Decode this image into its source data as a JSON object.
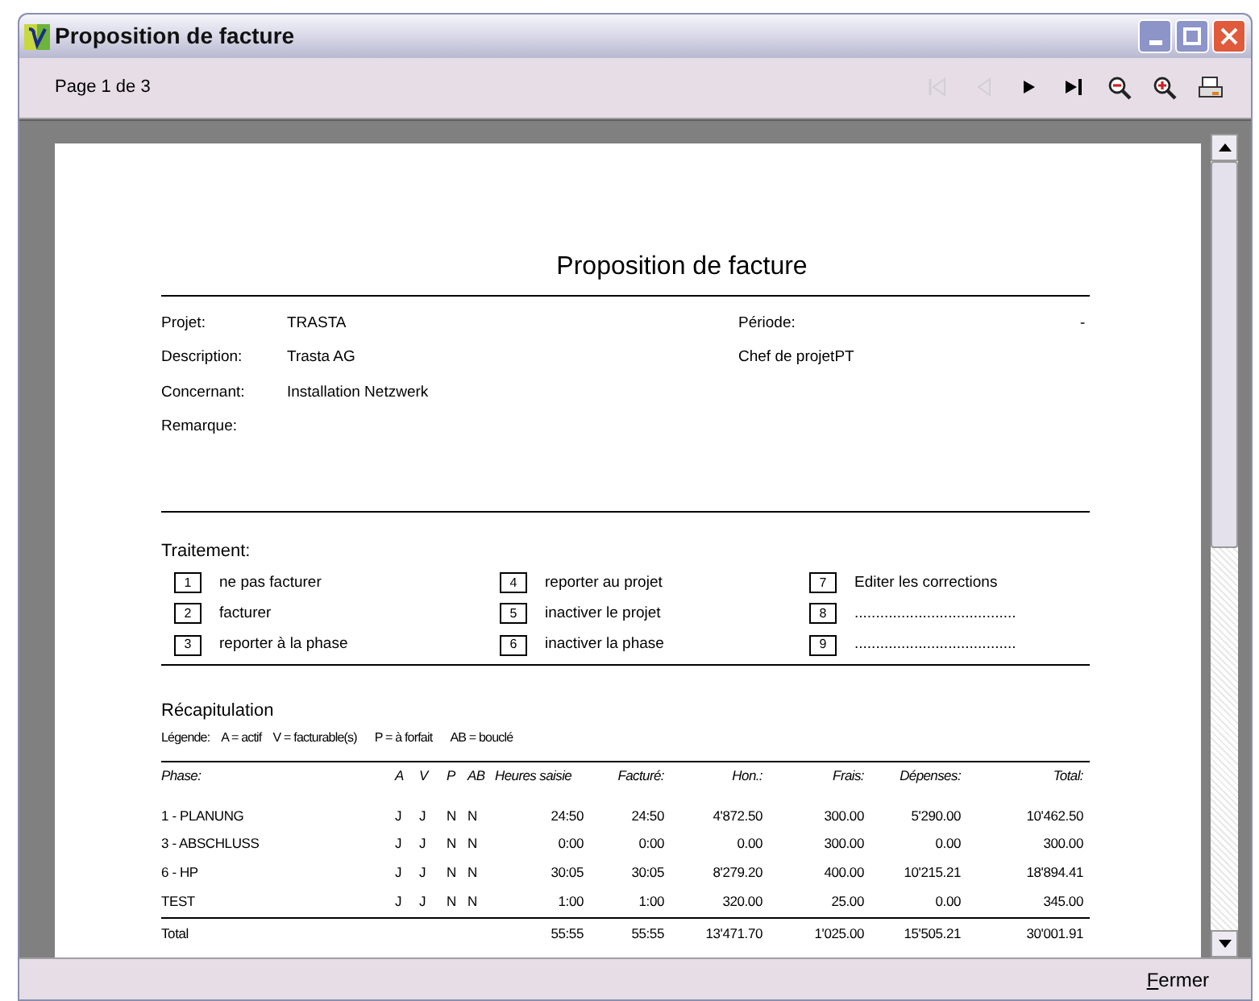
{
  "window": {
    "title": "Proposition de facture"
  },
  "toolbar": {
    "page_label": "Page 1 de 3",
    "buttons": [
      {
        "kind": "first",
        "disabled": true
      },
      {
        "kind": "previous",
        "disabled": true
      },
      {
        "kind": "next",
        "disabled": false
      },
      {
        "kind": "last",
        "disabled": false
      },
      {
        "kind": "zoom_out",
        "disabled": false
      },
      {
        "kind": "zoom_in",
        "disabled": false
      },
      {
        "kind": "print",
        "disabled": false
      }
    ]
  },
  "document": {
    "title": "Proposition de facture",
    "info_left": [
      {
        "label": "Projet:",
        "value": "TRASTA"
      },
      {
        "label": "Description:",
        "value": "Trasta AG"
      },
      {
        "label": "Concernant:",
        "value": "Installation Netzwerk"
      },
      {
        "label": "Remarque:"
      }
    ],
    "info_right": [
      {
        "label": "Période:",
        "value": "-"
      },
      {
        "label": "Chef de projet",
        "value": "PT"
      }
    ],
    "treatment": {
      "heading": "Traitement:",
      "items": [
        {
          "number": "1",
          "label": "ne pas facturer"
        },
        {
          "number": "2",
          "label": "facturer"
        },
        {
          "number": "3",
          "label": "reporter à la phase"
        },
        {
          "number": "4",
          "label": "reporter au projet"
        },
        {
          "number": "5",
          "label": "inactiver le projet"
        },
        {
          "number": "6",
          "label": "inactiver la phase"
        },
        {
          "number": "7",
          "label": "Editer les corrections"
        },
        {
          "number": "8",
          "label": "......................................"
        },
        {
          "number": "9",
          "label": "......................................"
        }
      ]
    },
    "summary": {
      "heading": "Récapitulation",
      "legend": [
        "Légende:",
        "A = actif",
        "V = facturable(s)",
        "P = à forfait",
        "AB = bouclé"
      ],
      "columns": [
        "Phase:",
        "A",
        "V",
        "P",
        "AB",
        "Heures saisie",
        "Facturé:",
        "Hon.:",
        "Frais:",
        "Dépenses:",
        "Total:"
      ],
      "rows": [
        [
          "1 - PLANUNG",
          "J",
          "J",
          "N",
          "N",
          "24:50",
          "24:50",
          "4'872.50",
          "300.00",
          "5'290.00",
          "10'462.50"
        ],
        [
          "3 - ABSCHLUSS",
          "J",
          "J",
          "N",
          "N",
          "0:00",
          "0:00",
          "0.00",
          "300.00",
          "0.00",
          "300.00"
        ],
        [
          "6 - HP",
          "J",
          "J",
          "N",
          "N",
          "30:05",
          "30:05",
          "8'279.20",
          "400.00",
          "10'215.21",
          "18'894.41"
        ],
        [
          "TEST",
          "J",
          "J",
          "N",
          "N",
          "1:00",
          "1:00",
          "320.00",
          "25.00",
          "0.00",
          "345.00"
        ]
      ],
      "total": {
        "label": "Total",
        "values": [
          "55:55",
          "55:55",
          "13'471.70",
          "1'025.00",
          "15'505.21",
          "30'001.91"
        ]
      }
    }
  },
  "footer": {
    "close_button": "Fermer"
  }
}
